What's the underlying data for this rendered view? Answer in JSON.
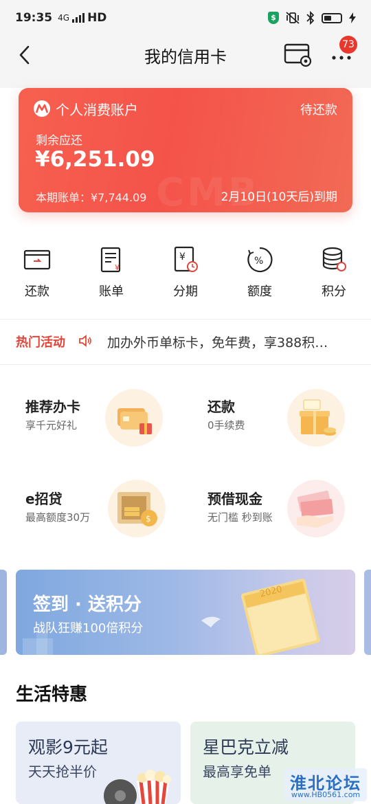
{
  "status_bar": {
    "time": "19:35",
    "network": "4G",
    "hd": "HD"
  },
  "nav": {
    "title": "我的信用卡",
    "badge_count": "73"
  },
  "account": {
    "title": "个人消费账户",
    "status": "待还款",
    "remaining_label": "剩余应还",
    "remaining_amount": "¥6,251.09",
    "statement": "本期账单：¥7,744.09",
    "due": "2月10日(10天后)到期"
  },
  "actions": [
    {
      "label": "还款",
      "icon": "repay-card-icon"
    },
    {
      "label": "账单",
      "icon": "bill-icon"
    },
    {
      "label": "分期",
      "icon": "installment-icon"
    },
    {
      "label": "额度",
      "icon": "credit-limit-icon"
    },
    {
      "label": "积分",
      "icon": "points-icon"
    }
  ],
  "hot": {
    "label": "热门活动",
    "text": "加办外币单标卡，免年费，享388积…"
  },
  "services": [
    {
      "title": "推荐办卡",
      "subtitle": "享千元好礼"
    },
    {
      "title": "还款",
      "subtitle": "0手续费"
    },
    {
      "title": "e招贷",
      "subtitle": "最高额度30万"
    },
    {
      "title": "预借现金",
      "subtitle": "无门槛 秒到账"
    }
  ],
  "banner": {
    "title": "签到 · 送积分",
    "subtitle": "战队狂赚100倍积分",
    "year": "2020"
  },
  "life": {
    "title": "生活特惠",
    "cards": [
      {
        "title": "观影9元起",
        "subtitle": "天天抢半价"
      },
      {
        "title": "星巴克立减",
        "subtitle": "最高享免单"
      }
    ]
  },
  "watermark": {
    "title": "淮北论坛",
    "url": "www.HB0561.com"
  },
  "colors": {
    "accent": "#e8372d",
    "card_red": "#f4534a",
    "hot_red": "#e0453a"
  }
}
